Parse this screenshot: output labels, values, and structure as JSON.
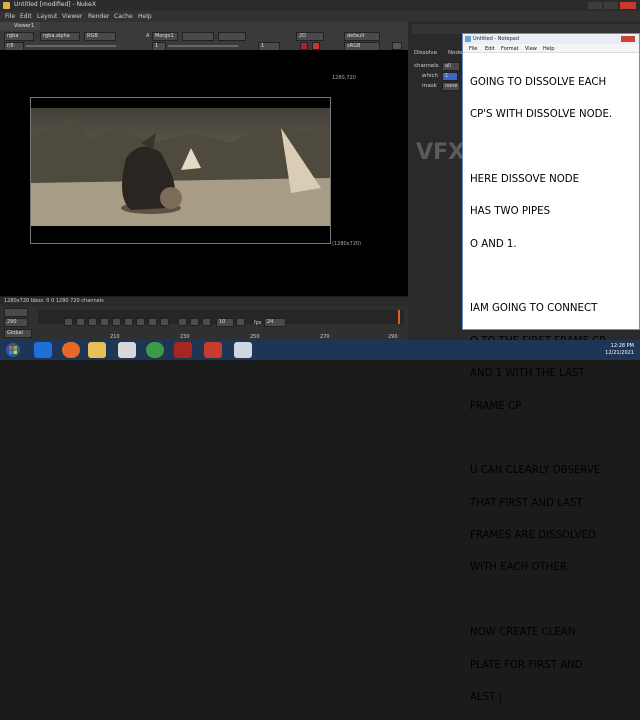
{
  "window": {
    "title": "Untitled [modified] - NukeX"
  },
  "menu": [
    "File",
    "Edit",
    "Layout",
    "Viewer",
    "Render",
    "Cache",
    "Help"
  ],
  "viewer": {
    "tab_label": "Viewer1",
    "channels": "rgba",
    "layer": "rgba.alpha",
    "colorspace": "RGB",
    "input_a": "A",
    "input_a_node": "Morgo1",
    "gain": "f/8",
    "frame_value": "1",
    "proxy": "1",
    "mode": "2D",
    "lut": "default",
    "display": "sRGB",
    "corner_top_right": "1280,720",
    "corner_bottom_right": "(1280x720)",
    "status": "1280x720  bbox: 0 0 1280 720 channels"
  },
  "timeline": {
    "fps_label": "fps",
    "fps_value": "24",
    "frame": "290",
    "step": "10",
    "global": "Global",
    "ticks": [
      "210",
      "230",
      "250",
      "270",
      "290"
    ]
  },
  "props": {
    "tab_dissolve": "Dissolve",
    "tab_node": "Node",
    "channels_label": "channels",
    "channels_value": "all",
    "which_label": "which",
    "which_value": "1",
    "mask_label": "mask",
    "mask_value": "none",
    "watermark": "VFX"
  },
  "notepad": {
    "title": "Untitled - Notepad",
    "menu": [
      "File",
      "Edit",
      "Format",
      "View",
      "Help"
    ],
    "lines": [
      "GOING TO DISSOLVE EACH",
      "CP'S WITH DISSOLVE NODE.",
      "",
      "HERE DISSOVE NODE",
      "HAS TWO PIPES",
      "O AND 1.",
      "",
      "IAM GOING TO CONNECT",
      "O TO THE FIRST FRAME CP",
      "AND 1 WITH THE LAST",
      "FRAME CP.",
      "",
      "U CAN CLEARLY OBSERVE",
      "THAT FIRST AND LAST",
      "FRAMES ARE DISSOLVED",
      "WITH EACH OTHER.",
      "",
      "NOW CREATE CLEAN",
      "PLATE FOR FIRST AND",
      "ALST |"
    ]
  },
  "taskbar": {
    "time": "12:28 PM",
    "date": "12/21/2021"
  }
}
